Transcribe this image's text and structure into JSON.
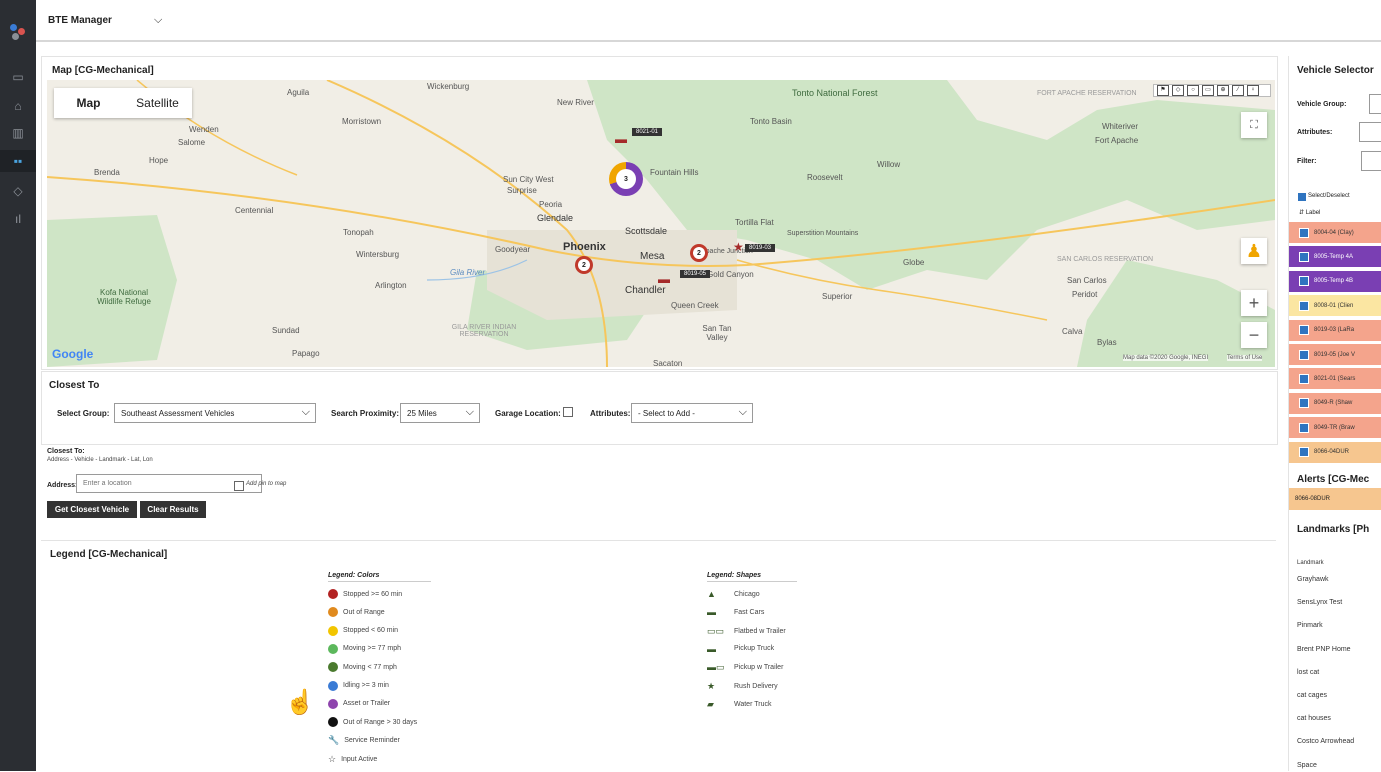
{
  "app": {
    "title": "BTE Manager"
  },
  "rail_icons": [
    "monitor-icon",
    "home-icon",
    "map-icon",
    "dashboard-icon",
    "pin-icon",
    "chart-icon"
  ],
  "map_panel": {
    "title": "Map  [CG-Mechanical]",
    "map_type": {
      "map": "Map",
      "satellite": "Satellite"
    },
    "places": [
      "Wickenburg",
      "Aguila",
      "Tonto National Forest",
      "FORT APACHE RESERVATION",
      "Whiteriver",
      "Fort Apache",
      "New River",
      "Morristown",
      "Tonto Basin",
      "Wenden",
      "Salome",
      "Hope",
      "Brenda",
      "Sun City West",
      "Surprise",
      "Fountain Hills",
      "Roosevelt",
      "Willow",
      "Centennial",
      "Peoria",
      "Glendale",
      "Tortilla Flat",
      "Superstition Mountains",
      "Tonopah",
      "Scottsdale",
      "Wintersburg",
      "Goodyear",
      "Phoenix",
      "Mesa",
      "Apache Junction",
      "Globe",
      "SAN CARLOS RESERVATION",
      "San Carlos",
      "Arlington",
      "Gila River",
      "Gold Canyon",
      "Chandler",
      "Superior",
      "Peridot",
      "Kofa National Wildlife Refuge",
      "Queen Creek",
      "Sundad",
      "GILA RIVER INDIAN RESERVATION",
      "San Tan Valley",
      "Calva",
      "Bylas",
      "Papago",
      "Sacaton"
    ],
    "vehicle_tags": [
      "8021-01",
      "8019-03",
      "8019-05"
    ],
    "clusters": [
      "3",
      "2",
      "2"
    ],
    "google": "Google",
    "attribution": "Map data ©2020 Google, INEGI",
    "terms": "Terms of Use"
  },
  "closest": {
    "title": "Closest To",
    "select_group_label": "Select Group:",
    "select_group_value": "Southeast Assessment Vehicles",
    "proximity_label": "Search Proximity:",
    "proximity_value": "25 Miles",
    "garage_label": "Garage Location:",
    "attributes_label": "Attributes:",
    "attributes_value": "- Select to Add -",
    "closest_to_label": "Closest To:",
    "closest_to_hint": "Address  -  Vehicle  -  Landmark  -  Lat, Lon",
    "address_label": "Address:",
    "address_placeholder": "Enter a location",
    "add_pin": "Add pin to map",
    "get_button": "Get Closest Vehicle",
    "clear_button": "Clear Results"
  },
  "legend": {
    "title": "Legend  [CG-Mechanical]",
    "colors_head": "Legend: Colors",
    "shapes_head": "Legend: Shapes",
    "colors": [
      {
        "label": "Stopped >= 60 min",
        "color": "#b22222"
      },
      {
        "label": "Out of Range",
        "color": "#e08a1e"
      },
      {
        "label": "Stopped < 60 min",
        "color": "#f2c500"
      },
      {
        "label": "Moving >= 77 mph",
        "color": "#5cb85c"
      },
      {
        "label": "Moving < 77 mph",
        "color": "#4a7a2e"
      },
      {
        "label": "Idling >= 3 min",
        "color": "#3a7bd5"
      },
      {
        "label": "Asset or Trailer",
        "color": "#8e44ad"
      },
      {
        "label": "Out of Range > 30 days",
        "color": "#111111"
      },
      {
        "label": "Service Reminder",
        "icon": "wrench-icon"
      },
      {
        "label": "Input Active",
        "icon": "star-outline-icon"
      }
    ],
    "shapes": [
      {
        "label": "Chicago",
        "icon": "tree-icon"
      },
      {
        "label": "Fast Cars",
        "icon": "car-icon"
      },
      {
        "label": "Flatbed w Trailer",
        "icon": "flatbed-icon"
      },
      {
        "label": "Pickup Truck",
        "icon": "pickup-icon"
      },
      {
        "label": "Pickup w Trailer",
        "icon": "pickup-trailer-icon"
      },
      {
        "label": "Rush Delivery",
        "icon": "star-icon"
      },
      {
        "label": "Water Truck",
        "icon": "water-truck-icon"
      }
    ]
  },
  "vehicle_selector": {
    "title": "Vehicle Selector",
    "group_label": "Vehicle Group:",
    "attributes_label": "Attributes:",
    "filter_label": "Filter:",
    "select_all": "Select/Deselect",
    "col_label": "Label",
    "vehicles": [
      {
        "label": "8004-04 (Clay)",
        "bg": "#f4a48c",
        "fg": "#333"
      },
      {
        "label": "8005-Temp 4A",
        "bg": "#7a3fb3",
        "fg": "#fff"
      },
      {
        "label": "8005-Temp 4B",
        "bg": "#7a3fb3",
        "fg": "#fff"
      },
      {
        "label": "8008-01 (Clien",
        "bg": "#fbe6a2",
        "fg": "#333"
      },
      {
        "label": "8019-03 (LaRa",
        "bg": "#f4a48c",
        "fg": "#333"
      },
      {
        "label": "8019-05 (Joe V",
        "bg": "#f4a48c",
        "fg": "#333"
      },
      {
        "label": "8021-01 (Sears",
        "bg": "#f4a48c",
        "fg": "#333"
      },
      {
        "label": "8049-R (Shaw",
        "bg": "#f4a48c",
        "fg": "#333"
      },
      {
        "label": "8049-TR (Braw",
        "bg": "#f4a48c",
        "fg": "#333"
      },
      {
        "label": "8066-04DUR",
        "bg": "#f6c68f",
        "fg": "#333"
      }
    ]
  },
  "alerts": {
    "title": "Alerts  [CG-Mec",
    "item": "8066-08DUR"
  },
  "landmarks": {
    "title": "Landmarks  [Ph",
    "col": "Landmark",
    "items": [
      "Grayhawk",
      "SensLynx Test",
      "Pinmark",
      "Brent PNP Home",
      "lost cat",
      "cat cages",
      "cat houses",
      "Costco Arrowhead",
      "Space"
    ]
  }
}
